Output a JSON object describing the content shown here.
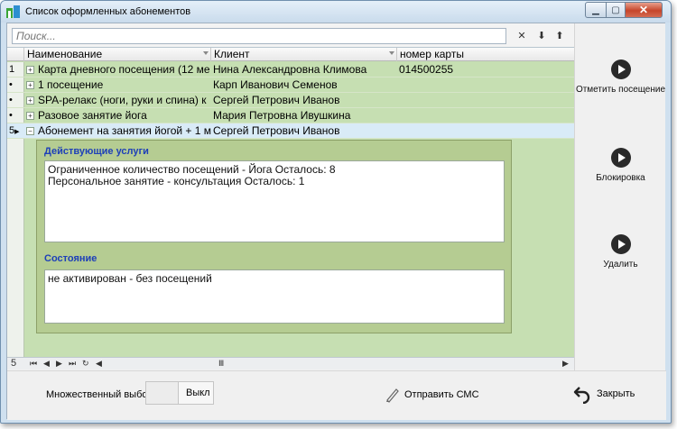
{
  "window": {
    "title": "Список оформленных абонементов"
  },
  "search": {
    "placeholder": "Поиск..."
  },
  "grid": {
    "columns": [
      "Наименование",
      "Клиент",
      "номер карты"
    ],
    "rows": [
      {
        "indicator": "1",
        "name": "Карта дневного посещения (12 ме",
        "client": "Нина Александровна Климова",
        "card": "014500255"
      },
      {
        "indicator": "•",
        "name": "1 посещение",
        "client": "Карп Иванович Семенов",
        "card": ""
      },
      {
        "indicator": "•",
        "name": "SPA-релакс (ноги, руки и спина) к",
        "client": "Сергей Петрович Иванов",
        "card": ""
      },
      {
        "indicator": "•",
        "name": "Разовое занятие йога",
        "client": "Мария Петровна Ивушкина",
        "card": ""
      },
      {
        "indicator": "5",
        "name": "Абонемент на занятия йогой + 1 м",
        "client": "Сергей Петрович Иванов",
        "card": ""
      }
    ],
    "detail": {
      "services_label": "Действующие услуги",
      "services": [
        "Ограниченное количество посещений - Йога Осталось: 8",
        "Персональное занятие - консультация Осталось: 1"
      ],
      "state_label": "Состояние",
      "state_value": "не активирован - без посещений"
    },
    "footer_count": "5"
  },
  "actions": {
    "mark_visit": "Отметить посещение",
    "block": "Блокировка",
    "delete": "Удалить"
  },
  "bottom": {
    "multi_select_label": "Множественный выбор",
    "toggle_state": "Выкл",
    "send_sms": "Отправить СМС",
    "close": "Закрыть"
  }
}
